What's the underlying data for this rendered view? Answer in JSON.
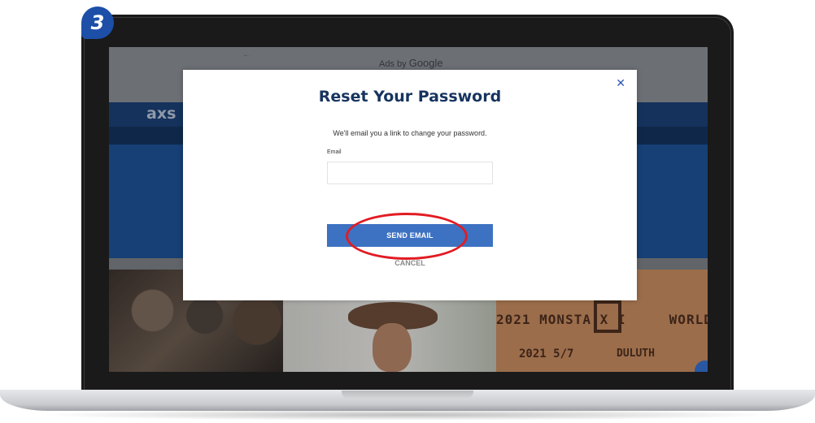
{
  "step": {
    "number": "3"
  },
  "ad": {
    "prefix": "Ads by",
    "brand": "Google",
    "arrow": "←"
  },
  "site": {
    "logo": "axs"
  },
  "modal": {
    "close_icon": "close-icon",
    "title": "Reset Your Password",
    "description": "We'll email you a link to change your password.",
    "email_label": "Email",
    "email_value": "",
    "email_placeholder": "",
    "send_label": "SEND EMAIL",
    "cancel_label": "CANCEL"
  },
  "events": {
    "card3_line1": "2021 MONSTA X I",
    "card3_line1_end": "WORLD TOUR",
    "card3_date": "2021 5/7",
    "card3_city": "DULUTH"
  },
  "colors": {
    "modal_title": "#17345f",
    "send_button": "#3d72c2",
    "highlight": "#e21b23",
    "step_badge": "#1d4fa8",
    "site_header": "#143d73"
  }
}
